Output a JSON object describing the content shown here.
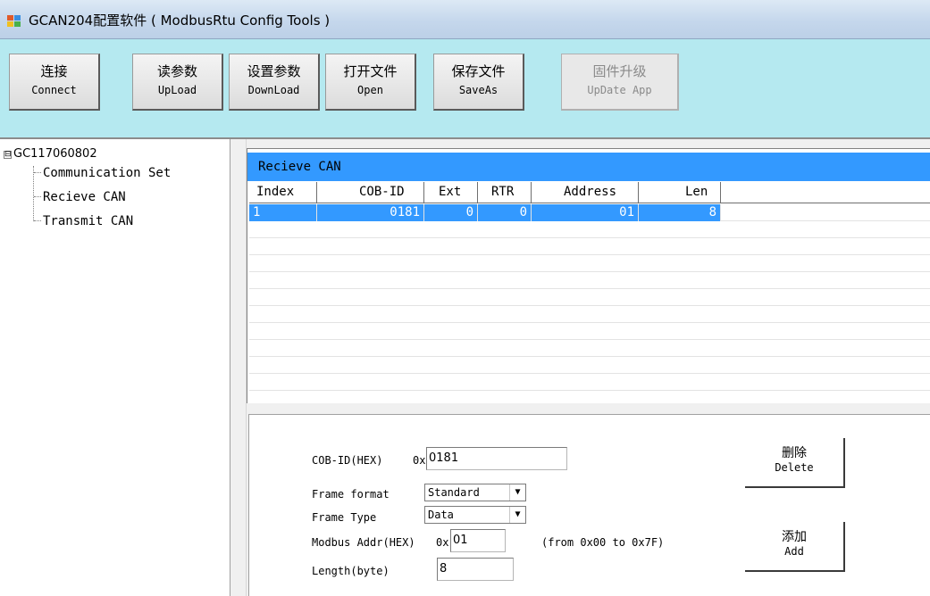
{
  "window": {
    "title": "GCAN204配置软件 ( ModbusRtu Config Tools )"
  },
  "toolbar": [
    {
      "zh": "连接",
      "en": "Connect",
      "enabled": true
    },
    {
      "zh": "读参数",
      "en": "UpLoad",
      "enabled": true
    },
    {
      "zh": "设置参数",
      "en": "DownLoad",
      "enabled": true
    },
    {
      "zh": "打开文件",
      "en": "Open",
      "enabled": true
    },
    {
      "zh": "保存文件",
      "en": "SaveAs",
      "enabled": true
    },
    {
      "zh": "固件升级",
      "en": "UpDate App",
      "enabled": false
    }
  ],
  "tree": {
    "expander": "⊟",
    "root": "GC117060802",
    "items": [
      "Communication Set",
      "Recieve CAN",
      "Transmit CAN"
    ]
  },
  "list": {
    "title": "Recieve CAN",
    "columns": [
      "Index",
      "COB-ID",
      "Ext",
      "RTR",
      "Address",
      "Len"
    ],
    "rows": [
      {
        "index": "1",
        "cob_id": "0181",
        "ext": "0",
        "rtr": "0",
        "address": "01",
        "len": "8",
        "selected": true
      }
    ]
  },
  "form": {
    "cob_id_label": "COB-ID(HEX)",
    "cob_prefix": "0x",
    "cob_id_value": "0181",
    "frame_format_label": "Frame format",
    "frame_format_value": "Standard",
    "frame_type_label": "Frame Type",
    "frame_type_value": "Data",
    "modbus_addr_label": "Modbus Addr(HEX)",
    "modbus_prefix": "0x",
    "modbus_addr_value": "01",
    "modbus_range_note": "(from 0x00 to 0x7F)",
    "length_label": "Length(byte)",
    "length_value": "8",
    "select_arrow": "▼",
    "delete_zh": "删除",
    "delete_en": "Delete",
    "add_zh": "添加",
    "add_en": "Add"
  },
  "colors": {
    "toolbar_bg": "#b5e9f0",
    "list_title_bg": "#3399ff",
    "selection": "#3399ff"
  }
}
